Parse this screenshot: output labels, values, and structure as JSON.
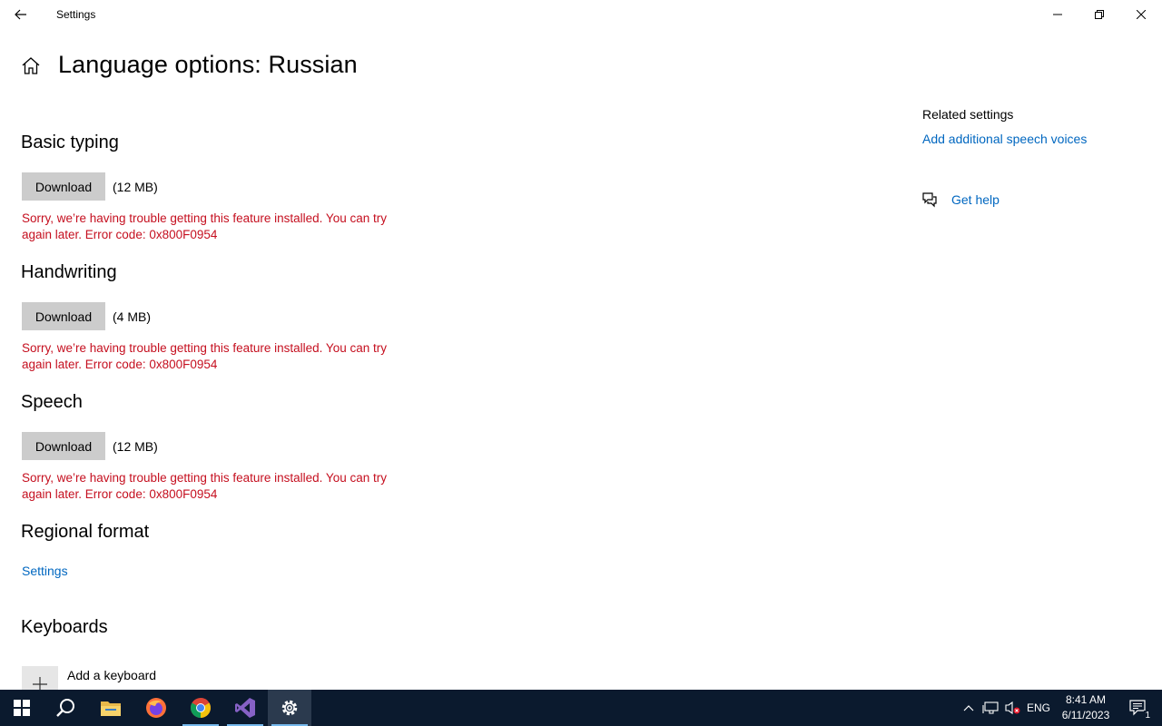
{
  "window": {
    "title": "Settings",
    "page_title": "Language options: Russian"
  },
  "sections": [
    {
      "heading": "Basic typing",
      "button_label": "Download",
      "size": "(12 MB)",
      "error": "Sorry, we’re having trouble getting this feature installed. You can try again later. Error code: 0x800F0954"
    },
    {
      "heading": "Handwriting",
      "button_label": "Download",
      "size": "(4 MB)",
      "error": "Sorry, we’re having trouble getting this feature installed. You can try again later. Error code: 0x800F0954"
    },
    {
      "heading": "Speech",
      "button_label": "Download",
      "size": "(12 MB)",
      "error": "Sorry, we’re having trouble getting this feature installed. You can try again later. Error code: 0x800F0954"
    }
  ],
  "regional": {
    "heading": "Regional format",
    "link": "Settings"
  },
  "keyboards": {
    "heading": "Keyboards",
    "add_label": "Add a keyboard"
  },
  "related": {
    "title": "Related settings",
    "link": "Add additional speech voices",
    "help": "Get help"
  },
  "taskbar": {
    "apps": [
      "start-icon",
      "search-icon",
      "file-explorer-icon",
      "firefox-icon",
      "chrome-icon",
      "visual-studio-icon",
      "settings-icon"
    ],
    "language": "ENG",
    "time": "8:41 AM",
    "date": "6/11/2023",
    "notification_count": "1"
  },
  "colors": {
    "error": "#c50f1f",
    "link": "#0067c0",
    "taskbar": "#0b1a2e"
  }
}
